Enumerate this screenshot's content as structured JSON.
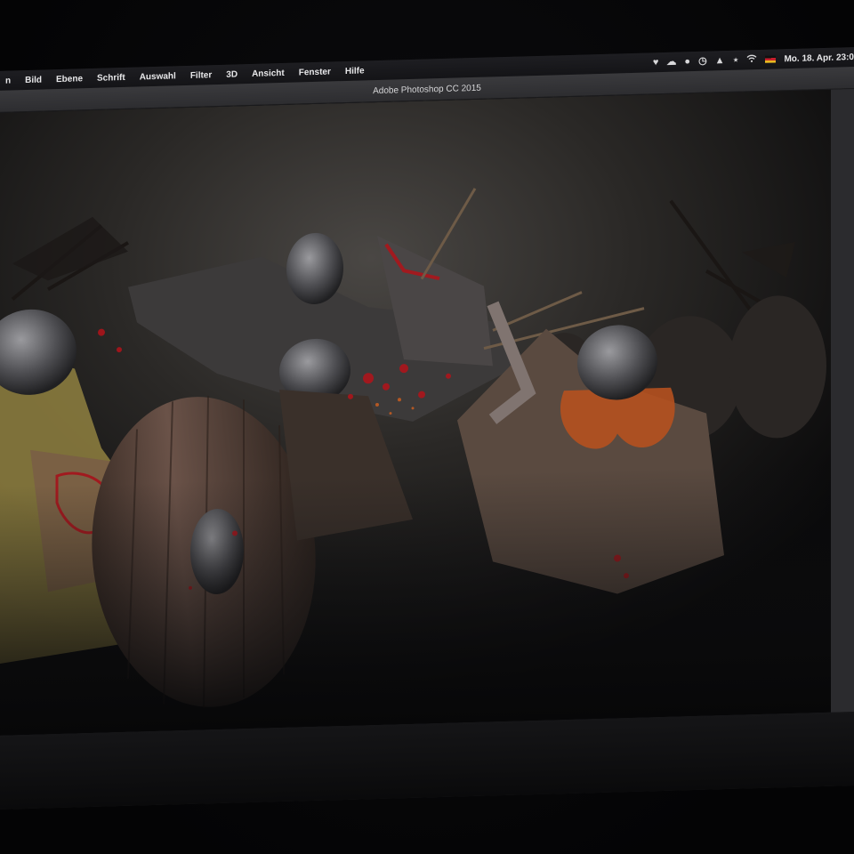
{
  "menubar": {
    "items": [
      {
        "label": "n"
      },
      {
        "label": "Bild"
      },
      {
        "label": "Ebene"
      },
      {
        "label": "Schrift"
      },
      {
        "label": "Auswahl"
      },
      {
        "label": "Filter"
      },
      {
        "label": "3D"
      },
      {
        "label": "Ansicht"
      },
      {
        "label": "Fenster"
      },
      {
        "label": "Hilfe"
      }
    ],
    "status_icons": [
      "heart-icon",
      "cloud-icon",
      "chat-icon",
      "time-machine-icon",
      "volume-icon",
      "bluetooth-icon",
      "wifi-icon",
      "flag-de-icon"
    ],
    "datetime": "Mo. 18. Apr. 23:0"
  },
  "window": {
    "title": "Adobe Photoshop CC 2015"
  },
  "colors": {
    "menubar_bg": "#18181b",
    "titlebar_bg": "#333336",
    "canvas_bg": "#0e0e10",
    "blood_red": "#b3131a",
    "beard_orange": "#b5511f"
  }
}
